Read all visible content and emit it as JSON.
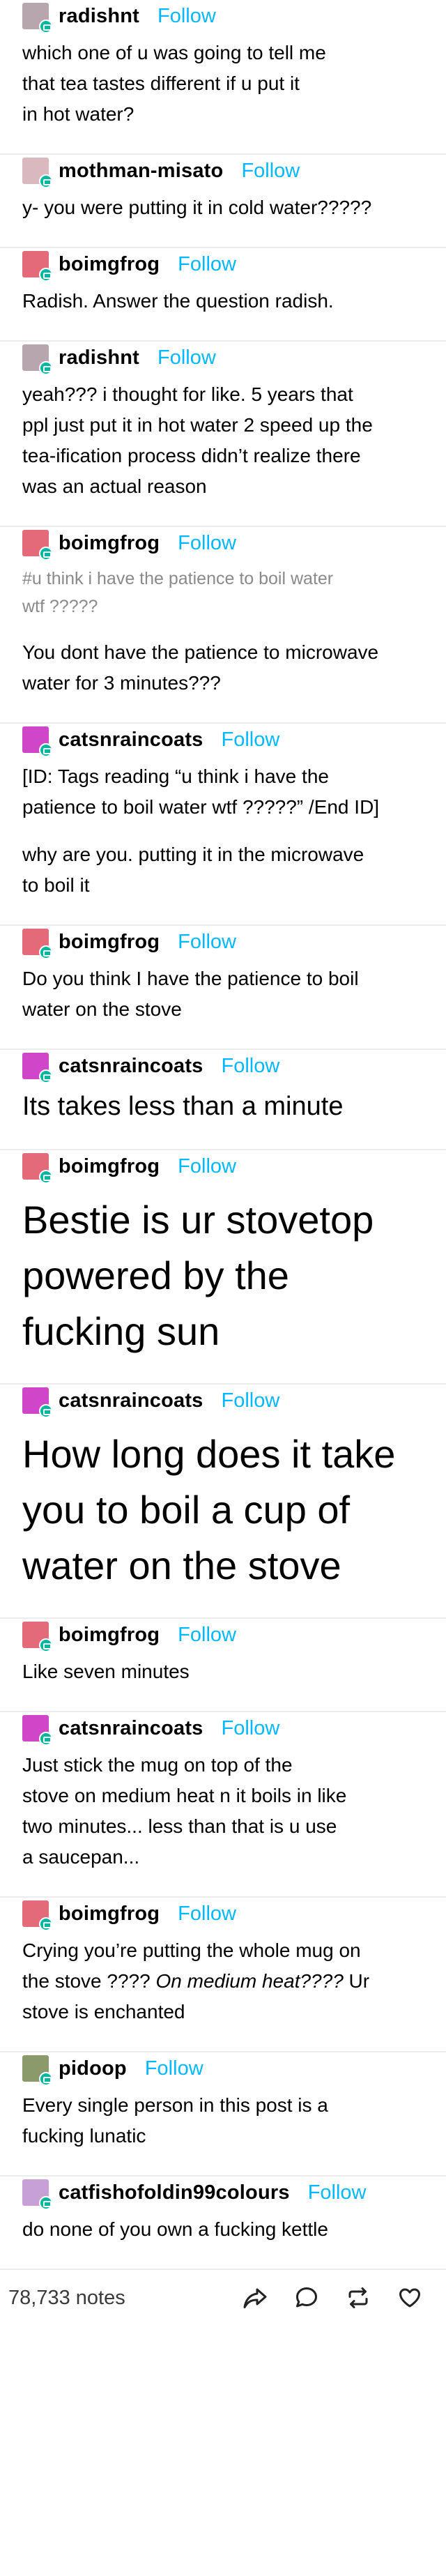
{
  "follow_label": "Follow",
  "posts": [
    {
      "user": "radishnt",
      "avatar_color": "#b7a6ad",
      "text": "which one of u was going to tell me\nthat tea tastes different if u put it\nin hot water?"
    },
    {
      "user": "mothman-misato",
      "avatar_color": "#d9b8c0",
      "text": "y- you were putting it in cold water?????"
    },
    {
      "user": "boimgfrog",
      "avatar_color": "#e46a7a",
      "text": "Radish. Answer the question radish."
    },
    {
      "user": "radishnt",
      "avatar_color": "#b7a6ad",
      "text": "yeah??? i thought for like. 5 years that\nppl just put it in hot water 2 speed up the\ntea-ification process didn’t realize there\nwas an actual reason"
    },
    {
      "user": "boimgfrog",
      "avatar_color": "#e46a7a",
      "tags": "#u think i have the patience to boil water\nwtf ?????",
      "text": "You dont have the patience to microwave\nwater for 3 minutes???"
    },
    {
      "user": "catsnraincoats",
      "avatar_color": "#d046c8",
      "text": "[ID: Tags reading “u think i have the\npatience to boil water wtf ?????” /End ID]",
      "text2": "why are you. putting it in the microwave\nto boil it"
    },
    {
      "user": "boimgfrog",
      "avatar_color": "#e46a7a",
      "text": "Do you think I have the patience to boil\nwater on the stove"
    },
    {
      "user": "catsnraincoats",
      "avatar_color": "#d046c8",
      "big": "Its takes less than a minute"
    },
    {
      "user": "boimgfrog",
      "avatar_color": "#e46a7a",
      "huge": "Bestie is ur stovetop\npowered by the\nfucking sun"
    },
    {
      "user": "catsnraincoats",
      "avatar_color": "#d046c8",
      "huge": "How long does it take\nyou to boil a cup of\nwater on the stove"
    },
    {
      "user": "boimgfrog",
      "avatar_color": "#e46a7a",
      "text": "Like seven minutes"
    },
    {
      "user": "catsnraincoats",
      "avatar_color": "#d046c8",
      "text": "Just stick the mug on top of the\nstove on medium heat n it boils in like\ntwo minutes... less than that is u use\na saucepan..."
    },
    {
      "user": "boimgfrog",
      "avatar_color": "#e46a7a",
      "text_a": "Crying you’re putting the whole mug on\nthe stove ???? ",
      "text_em": "On medium heat????",
      "text_b": " Ur\nstove is enchanted"
    },
    {
      "user": "pidoop",
      "avatar_color": "#8a9a6a",
      "text": "Every single person in this post is a\nfucking lunatic"
    },
    {
      "user": "catfishofoldin99colours",
      "avatar_color": "#c8a0d8",
      "text": "do none of you own a fucking kettle"
    }
  ],
  "footer": {
    "notes": "78,733 notes",
    "share_icon": "share-icon",
    "reply_icon": "reply-icon",
    "reblog_icon": "reblog-icon",
    "like_icon": "heart-icon"
  }
}
